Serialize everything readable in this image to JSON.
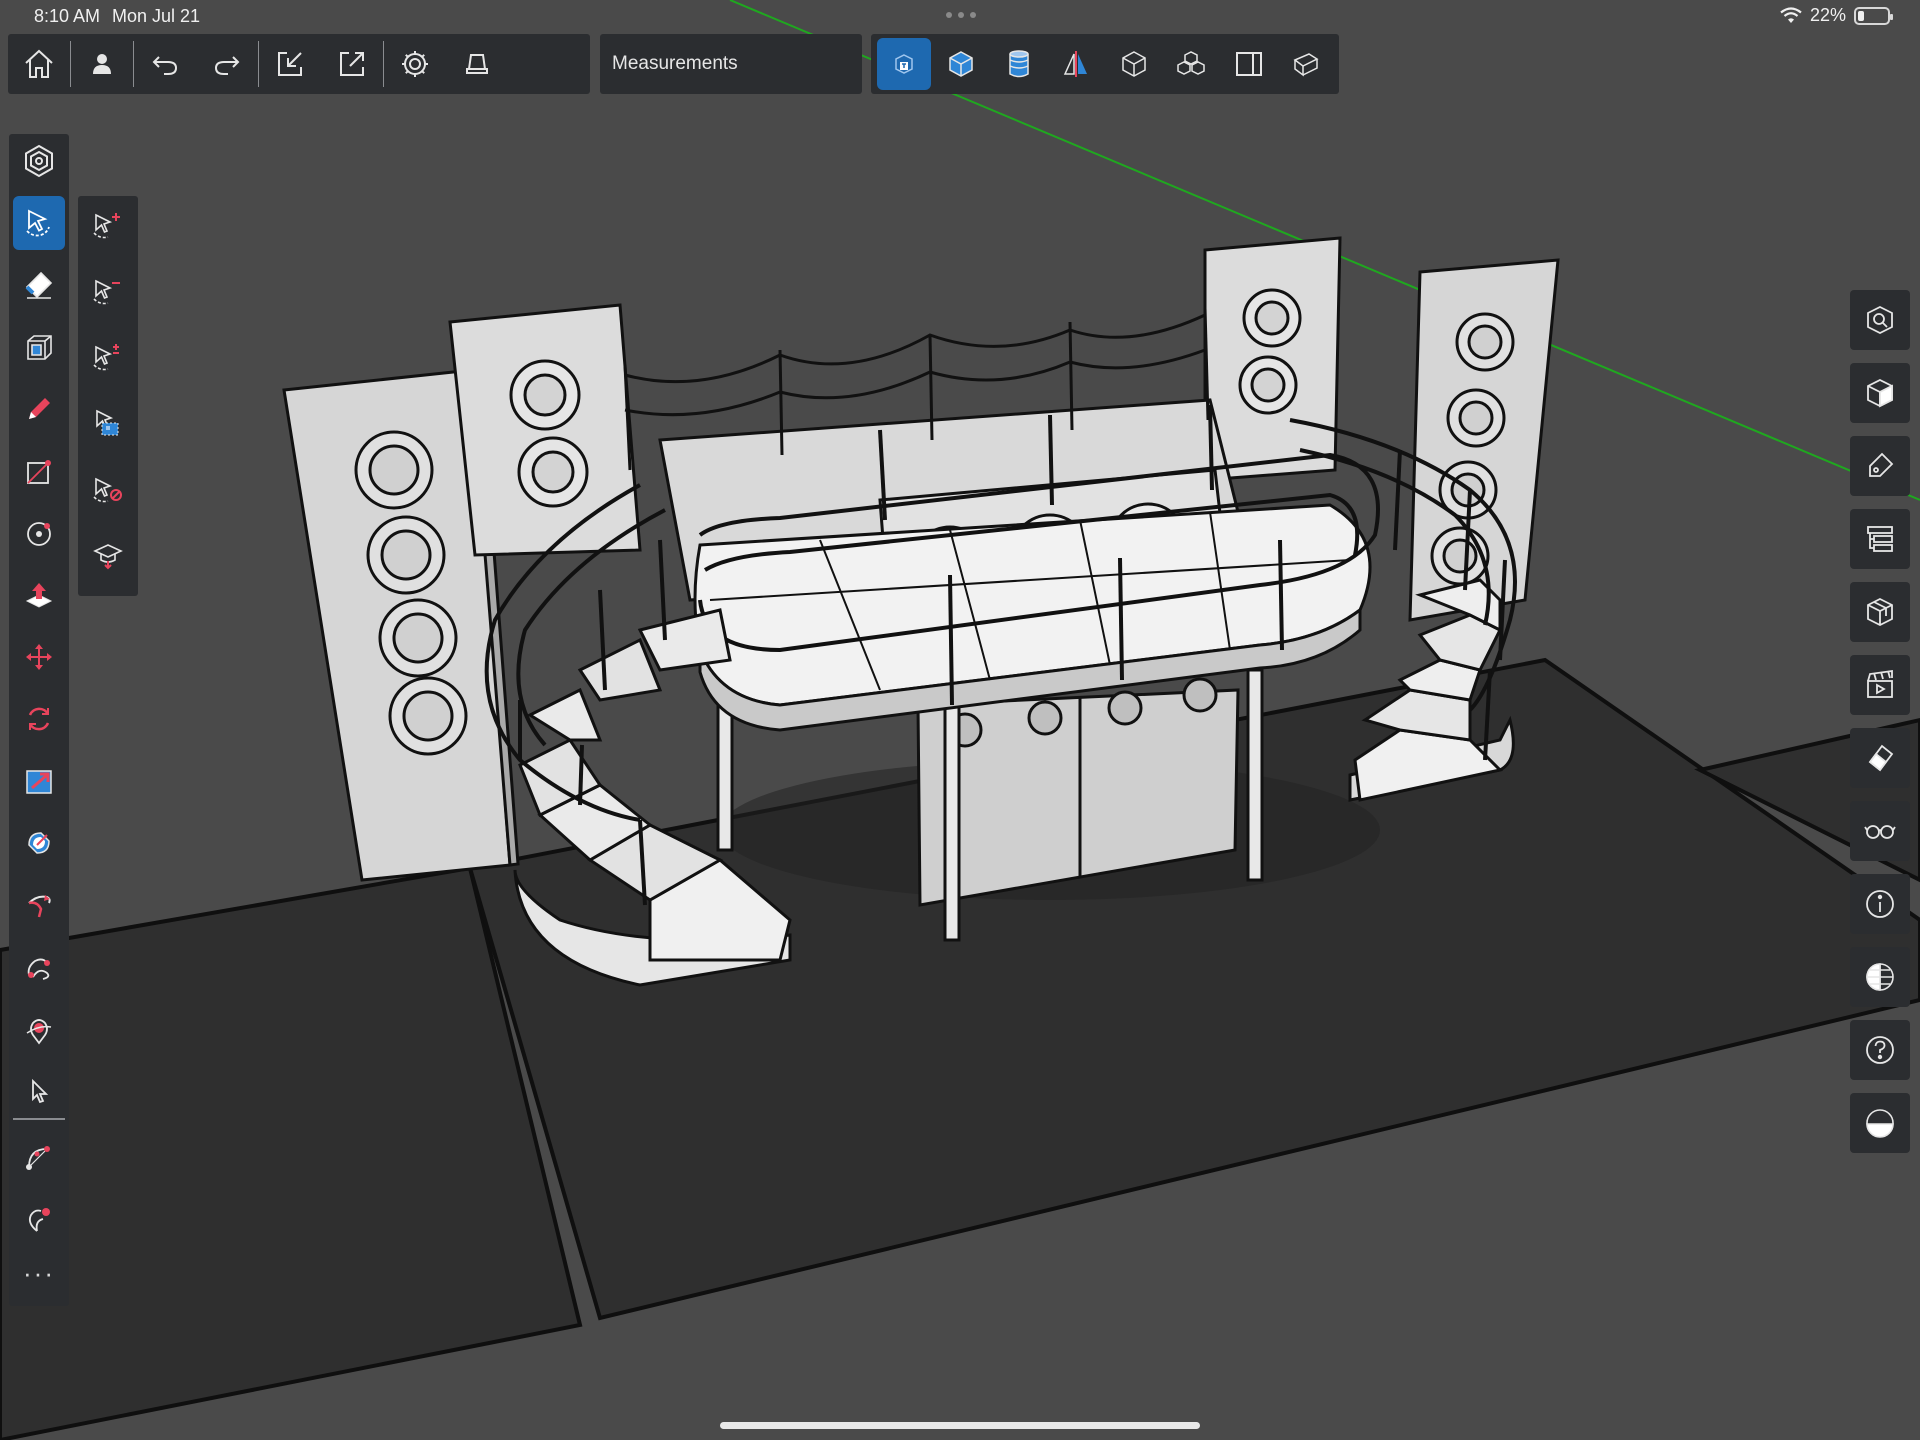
{
  "status_bar": {
    "time": "8:10 AM",
    "date": "Mon Jul 21",
    "battery": "22%",
    "battery_level": 0.22
  },
  "main_toolbar": {
    "items": [
      {
        "name": "home-button",
        "icon": "home-icon"
      },
      {
        "name": "account-button",
        "icon": "user-icon"
      },
      {
        "name": "undo-button",
        "icon": "undo-icon"
      },
      {
        "name": "redo-button",
        "icon": "redo-icon"
      },
      {
        "name": "import-button",
        "icon": "import-icon"
      },
      {
        "name": "export-button",
        "icon": "export-icon"
      },
      {
        "name": "settings-button",
        "icon": "gear-icon"
      },
      {
        "name": "display-button",
        "icon": "display-icon"
      }
    ]
  },
  "tray": {
    "title": "Measurements"
  },
  "view_toolbar": {
    "active_index": 0,
    "items": [
      {
        "name": "view-perspective",
        "icon": "perspective-cube-icon"
      },
      {
        "name": "view-iso",
        "icon": "iso-cube-icon"
      },
      {
        "name": "view-section",
        "icon": "cylinder-icon"
      },
      {
        "name": "view-mirror",
        "icon": "mirror-icon"
      },
      {
        "name": "view-wireframe",
        "icon": "wireframe-cube-icon"
      },
      {
        "name": "view-components",
        "icon": "components-icon"
      },
      {
        "name": "view-section-plane",
        "icon": "section-plane-icon"
      },
      {
        "name": "view-solid",
        "icon": "solid-cube-icon"
      }
    ]
  },
  "left_toolbar": {
    "active_index": 1,
    "items": [
      {
        "name": "components-tool",
        "icon": "hexagon-icon"
      },
      {
        "name": "select-tool",
        "icon": "select-lasso-icon"
      },
      {
        "name": "eraser-tool",
        "icon": "eraser-icon"
      },
      {
        "name": "paint-tool",
        "icon": "paint-bucket-icon"
      },
      {
        "name": "line-tool",
        "icon": "pencil-icon"
      },
      {
        "name": "rectangle-tool",
        "icon": "rectangle-icon"
      },
      {
        "name": "circle-tool",
        "icon": "circle-icon"
      },
      {
        "name": "push-pull-tool",
        "icon": "push-pull-icon"
      },
      {
        "name": "move-tool",
        "icon": "move-icon"
      },
      {
        "name": "rotate-tool",
        "icon": "rotate-icon"
      },
      {
        "name": "scale-tool",
        "icon": "scale-icon"
      },
      {
        "name": "offset-tool",
        "icon": "offset-icon"
      },
      {
        "name": "follow-me-tool",
        "icon": "follow-me-icon"
      },
      {
        "name": "tape-measure-tool",
        "icon": "tape-measure-icon"
      },
      {
        "name": "orbit-tool",
        "icon": "orbit-icon"
      },
      {
        "name": "arrow-tool",
        "icon": "cursor-arrow-icon"
      },
      {
        "name": "arc-tool",
        "icon": "arc-icon"
      },
      {
        "name": "freehand-tool",
        "icon": "freehand-icon"
      }
    ],
    "more_label": "···"
  },
  "sub_toolbar": {
    "items": [
      {
        "name": "select-add-button",
        "icon": "select-add-icon",
        "badge": "+"
      },
      {
        "name": "select-subtract-button",
        "icon": "select-subtract-icon",
        "badge": "−"
      },
      {
        "name": "select-toggle-button",
        "icon": "select-toggle-icon",
        "badge": "±"
      },
      {
        "name": "select-box-button",
        "icon": "select-box-icon",
        "badge": ""
      },
      {
        "name": "select-clear-button",
        "icon": "select-clear-icon",
        "badge": ""
      },
      {
        "name": "instructor-button",
        "icon": "graduation-cap-icon",
        "badge": ""
      }
    ]
  },
  "right_toolbar": {
    "items": [
      {
        "name": "search-panel-button",
        "icon": "search-cube-icon"
      },
      {
        "name": "views-panel-button",
        "icon": "cube-icon"
      },
      {
        "name": "materials-panel-button",
        "icon": "tag-icon"
      },
      {
        "name": "outliner-panel-button",
        "icon": "outliner-icon"
      },
      {
        "name": "components-panel-button",
        "icon": "component-cube-icon"
      },
      {
        "name": "scenes-panel-button",
        "icon": "clapperboard-icon"
      },
      {
        "name": "styles-panel-button",
        "icon": "styles-icon"
      },
      {
        "name": "xray-panel-button",
        "icon": "glasses-icon"
      },
      {
        "name": "entity-info-button",
        "icon": "info-icon"
      },
      {
        "name": "display-panel-button",
        "icon": "globe-icon"
      },
      {
        "name": "help-button",
        "icon": "help-icon"
      },
      {
        "name": "shadows-button",
        "icon": "half-circle-icon"
      }
    ]
  },
  "colors": {
    "background": "#4a4a4a",
    "panel": "#2b2d30",
    "accent": "#1e69b0",
    "accent_red": "#e8445c",
    "ground": "#2f2f2f",
    "model_fill": "#e9e9e9",
    "axis_green": "#1fa81f"
  }
}
